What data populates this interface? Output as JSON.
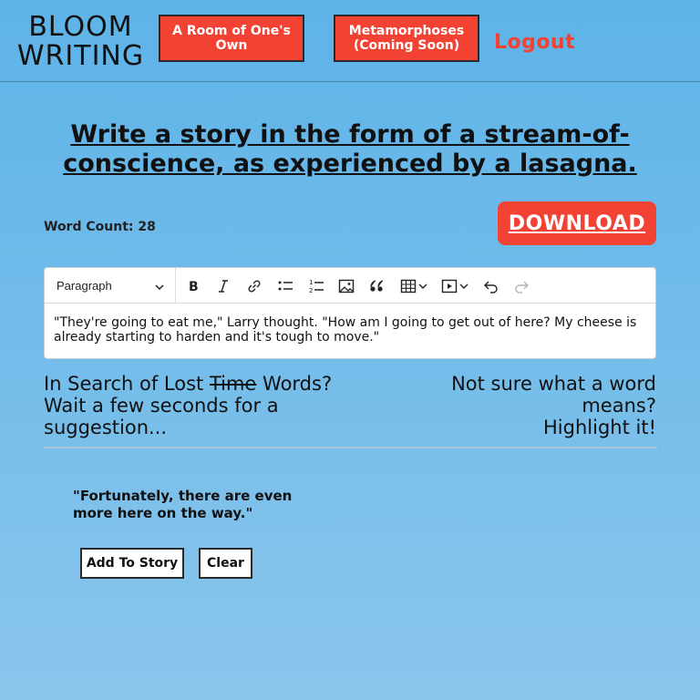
{
  "brand": {
    "line1": "BLOOM",
    "line2": "WRITING"
  },
  "nav": {
    "room_label": "A Room of One's Own",
    "metamorphoses_label": "Metamorphoses (Coming Soon)",
    "logout_label": "Logout"
  },
  "prompt": "Write a story in the form of a stream-of-conscience, as experienced by a lasagna.",
  "word_count": {
    "label": "Word Count:",
    "value": "28"
  },
  "download_label": "DOWNLOAD",
  "editor": {
    "block_format": "Paragraph",
    "toolbar_icons": [
      "bold-icon",
      "italic-icon",
      "link-icon",
      "bullet-list-icon",
      "numbered-list-icon",
      "image-icon",
      "blockquote-icon",
      "table-icon",
      "media-icon",
      "undo-icon",
      "redo-icon"
    ],
    "content": "\"They're going to eat me,\" Larry thought. \"How am I going to get out of here? My cheese is already starting to harden and it's tough to move.\""
  },
  "lost_words": {
    "prefix": "In Search of Lost ",
    "struck": "Time",
    "suffix": " Words?",
    "line2": "Wait a few seconds for a suggestion..."
  },
  "not_sure": {
    "line1": "Not sure what a word means?",
    "line2": "Highlight it!"
  },
  "suggestion": "\"Fortunately, there are even more here on the way.\"",
  "actions": {
    "add_label": "Add To Story",
    "clear_label": "Clear"
  },
  "colors": {
    "accent": "#f24234",
    "background": "#6cbae9"
  }
}
